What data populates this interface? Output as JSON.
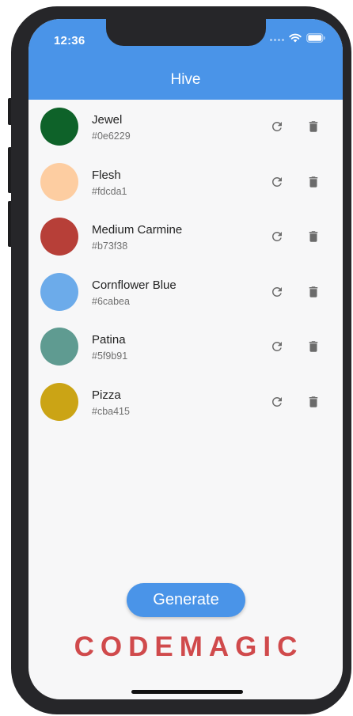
{
  "status_bar": {
    "time": "12:36",
    "icons": [
      "signal-icon",
      "wifi-icon",
      "battery-icon"
    ]
  },
  "app_bar": {
    "title": "Hive",
    "color": "#4a94e8"
  },
  "colors": [
    {
      "name": "Jewel",
      "hex": "#0e6229"
    },
    {
      "name": "Flesh",
      "hex": "#fdcda1"
    },
    {
      "name": "Medium Carmine",
      "hex": "#b73f38"
    },
    {
      "name": "Cornflower Blue",
      "hex": "#6cabea"
    },
    {
      "name": "Patina",
      "hex": "#5f9b91"
    },
    {
      "name": "Pizza",
      "hex": "#cba415"
    }
  ],
  "item_actions": {
    "refresh_icon": "refresh-icon",
    "delete_icon": "trash-icon"
  },
  "generate_button": {
    "label": "Generate"
  },
  "brand": {
    "text": "CODEMAGIC",
    "color": "#d04a4c"
  }
}
